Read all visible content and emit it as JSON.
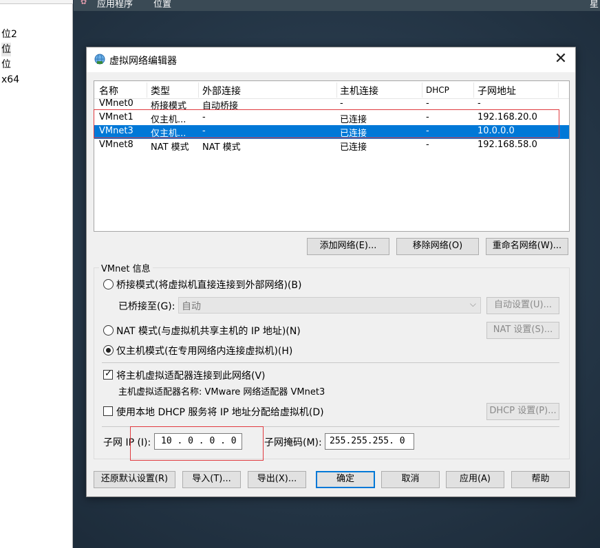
{
  "left_panel": {
    "items": [
      "位2",
      "位",
      "位",
      "x64"
    ]
  },
  "top_bar": {
    "menu_apps": "应用程序",
    "menu_places": "位置",
    "right_text": "星"
  },
  "dialog": {
    "title": "虚拟网络编辑器",
    "close_symbol": "✕",
    "columns": [
      "名称",
      "类型",
      "外部连接",
      "主机连接",
      "DHCP",
      "子网地址"
    ],
    "rows": [
      {
        "name": "VMnet0",
        "type": "桥接模式",
        "external": "自动桥接",
        "host": "-",
        "dhcp": "-",
        "subnet": "-"
      },
      {
        "name": "VMnet1",
        "type": "仅主机...",
        "external": "-",
        "host": "已连接",
        "dhcp": "-",
        "subnet": "192.168.20.0"
      },
      {
        "name": "VMnet3",
        "type": "仅主机...",
        "external": "-",
        "host": "已连接",
        "dhcp": "-",
        "subnet": "10.0.0.0"
      },
      {
        "name": "VMnet8",
        "type": "NAT 模式",
        "external": "NAT 模式",
        "host": "已连接",
        "dhcp": "-",
        "subnet": "192.168.58.0"
      }
    ],
    "selected_row": "VMnet3",
    "buttons": {
      "add_network": "添加网络(E)...",
      "remove_network": "移除网络(O)",
      "rename_network": "重命名网络(W)..."
    },
    "vmnet_info": {
      "group_title": "VMnet 信息",
      "bridged_label": "桥接模式(将虚拟机直接连接到外部网络)(B)",
      "bridged_to_label": "已桥接至(G):",
      "bridged_to_value": "自动",
      "auto_settings": "自动设置(U)...",
      "nat_label": "NAT 模式(与虚拟机共享主机的 IP 地址)(N)",
      "nat_settings": "NAT 设置(S)...",
      "hostonly_label": "仅主机模式(在专用网络内连接虚拟机)(H)",
      "mode_selected": "hostonly",
      "connect_adapter_label": "将主机虚拟适配器连接到此网络(V)",
      "connect_adapter_checked": true,
      "adapter_name_text": "主机虚拟适配器名称: VMware 网络适配器 VMnet3",
      "dhcp_label": "使用本地 DHCP 服务将 IP 地址分配给虚拟机(D)",
      "dhcp_checked": false,
      "dhcp_settings": "DHCP 设置(P)...",
      "subnet_ip_label": "子网 IP (I):",
      "subnet_ip_value": "10 . 0 . 0 . 0",
      "subnet_mask_label": "子网掩码(M):",
      "subnet_mask_value": "255.255.255. 0"
    },
    "footer": {
      "restore_defaults": "还原默认设置(R)",
      "import": "导入(T)...",
      "export": "导出(X)...",
      "ok": "确定",
      "cancel": "取消",
      "apply": "应用(A)",
      "help": "帮助"
    }
  },
  "colors": {
    "selection": "#0078d7",
    "annotation": "#e0393e"
  }
}
